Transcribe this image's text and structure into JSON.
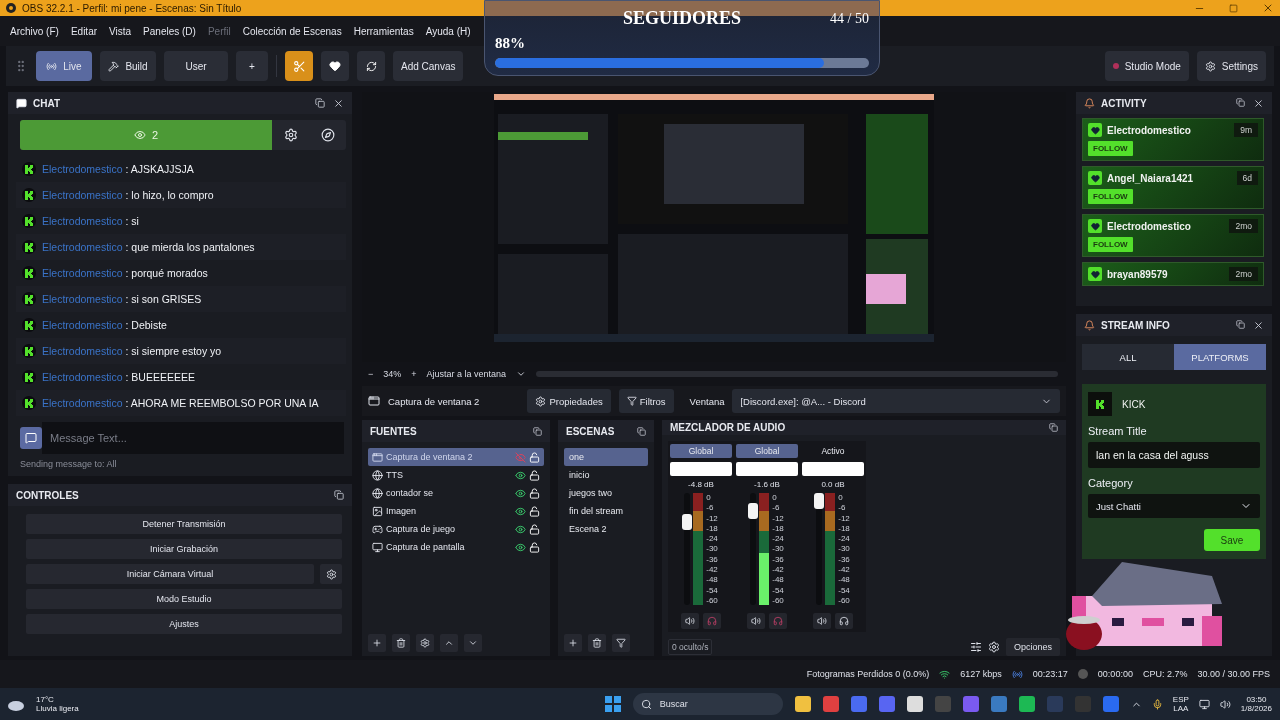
{
  "window": {
    "title": "OBS 32.2.1 - Perfil: mi pene - Escenas: Sin Título"
  },
  "menu": [
    {
      "label": "Archivo (F)",
      "disabled": false
    },
    {
      "label": "Editar",
      "disabled": false
    },
    {
      "label": "Vista",
      "disabled": false
    },
    {
      "label": "Paneles (D)",
      "disabled": false
    },
    {
      "label": "Perfil",
      "disabled": true
    },
    {
      "label": "Colección de Escenas",
      "disabled": false
    },
    {
      "label": "Herramientas",
      "disabled": false
    },
    {
      "label": "Ayuda (H)",
      "disabled": false
    }
  ],
  "toolbar": {
    "modes": [
      {
        "label": "Live",
        "kind": "live",
        "selected": true
      },
      {
        "label": "Build",
        "kind": "build",
        "selected": false
      },
      {
        "label": "User",
        "kind": "user",
        "selected": false
      }
    ],
    "add": "+",
    "tools": [
      {
        "kind": "tools",
        "active": true
      },
      {
        "kind": "favorite",
        "active": false
      },
      {
        "kind": "swap",
        "active": false
      }
    ],
    "add_canvas": "Add Canvas",
    "studio_mode": "Studio Mode",
    "settings": "Settings"
  },
  "goal_overlay": {
    "title": "SEGUIDORES",
    "count": "44 / 50",
    "percent": "88%",
    "level": 0.88
  },
  "chat": {
    "title": "CHAT",
    "viewers": "2",
    "separator": ":",
    "messages": [
      {
        "user": "Electrodomestico",
        "text": "AJSKAJJSJA"
      },
      {
        "user": "Electrodomestico",
        "text": "lo hizo, lo compro"
      },
      {
        "user": "Electrodomestico",
        "text": "si"
      },
      {
        "user": "Electrodomestico",
        "text": "que mierda los pantalones"
      },
      {
        "user": "Electrodomestico",
        "text": "porqué morados"
      },
      {
        "user": "Electrodomestico",
        "text": "si son GRISES"
      },
      {
        "user": "Electrodomestico",
        "text": "Debiste"
      },
      {
        "user": "Electrodomestico",
        "text": "si siempre estoy yo"
      },
      {
        "user": "Electrodomestico",
        "text": "BUEEEEEEE"
      },
      {
        "user": "Electrodomestico",
        "text": "AHORA ME REEMBOLSO POR UNA IA"
      }
    ],
    "input": {
      "placeholder": "Message Text..."
    },
    "sending_to": "Sending message to: All"
  },
  "controls": {
    "title": "CONTROLES",
    "buttons": [
      "Detener Transmisión",
      "Iniciar Grabación",
      "Iniciar Cámara Virtual",
      "Modo Estudio",
      "Ajustes"
    ]
  },
  "preview": {
    "zoom_out": "−",
    "zoom": "34%",
    "zoom_in": "+",
    "fit": "Ajustar a la ventana"
  },
  "source_bar": {
    "source": "Captura de ventana 2",
    "properties": "Propiedades",
    "filters": "Filtros",
    "window_label": "Ventana",
    "window_value": "[Discord.exe]: @A... - Discord"
  },
  "sources": {
    "title": "FUENTES",
    "items": [
      {
        "name": "Captura de ventana 2",
        "kind": "window",
        "selected": true,
        "visible": false
      },
      {
        "name": "TTS",
        "kind": "browser",
        "selected": false,
        "visible": true
      },
      {
        "name": "contador se",
        "kind": "browser",
        "selected": false,
        "visible": true
      },
      {
        "name": "Imagen",
        "kind": "image",
        "selected": false,
        "visible": true
      },
      {
        "name": "Captura de juego",
        "kind": "game",
        "selected": false,
        "visible": true
      },
      {
        "name": "Captura de pantalla",
        "kind": "display",
        "selected": false,
        "visible": true
      }
    ]
  },
  "scenes": {
    "title": "ESCENAS",
    "items": [
      {
        "name": "one",
        "selected": true
      },
      {
        "name": "inicio",
        "selected": false
      },
      {
        "name": "juegos two",
        "selected": false
      },
      {
        "name": "fin del stream",
        "selected": false
      },
      {
        "name": "Escena 2",
        "selected": false
      }
    ]
  },
  "mixer": {
    "title": "MEZCLADOR DE AUDIO",
    "hidden": "0 oculto/s",
    "options": "Opciones",
    "channels": [
      {
        "tag": "Global",
        "tag_selected": true,
        "db": "-4.8 dB",
        "level": 0.78,
        "monitoring": true,
        "scale": [
          "0",
          "-6",
          "-12",
          "-18",
          "-24",
          "-30",
          "-36",
          "-42",
          "-48",
          "-54",
          "-60"
        ]
      },
      {
        "tag": "Global",
        "tag_selected": true,
        "db": "-1.6 dB",
        "level": 0.9,
        "monitoring": true,
        "scale": [
          "0",
          "-6",
          "-12",
          "-18",
          "-24",
          "-30",
          "-36",
          "-42",
          "-48",
          "-54",
          "-60"
        ]
      },
      {
        "tag": "Activo",
        "tag_selected": false,
        "db": "0.0 dB",
        "level": 1,
        "monitoring": false,
        "scale": [
          "0",
          "-6",
          "-12",
          "-18",
          "-24",
          "-30",
          "-36",
          "-42",
          "-48",
          "-54",
          "-60"
        ]
      }
    ]
  },
  "activity": {
    "title": "ACTIVITY",
    "events": [
      {
        "user": "Electrodomestico",
        "time": "9m",
        "action": "FOLLOW"
      },
      {
        "user": "Angel_Naiara1421",
        "time": "6d",
        "action": "FOLLOW"
      },
      {
        "user": "Electrodomestico",
        "time": "2mo",
        "action": "FOLLOW"
      },
      {
        "user": "brayan89579",
        "time": "2mo"
      }
    ]
  },
  "stream_info": {
    "title": "STREAM INFO",
    "tabs": [
      {
        "label": "ALL",
        "selected": false
      },
      {
        "label": "PLATFORMS",
        "selected": true
      }
    ],
    "platform": "KICK",
    "title_label": "Stream Title",
    "title_value": "lan en la casa del aguss",
    "category_label": "Category",
    "category_value": "Just Chatti",
    "save": "Save"
  },
  "status_bar": {
    "dropped": "Fotogramas Perdidos 0 (0.0%)",
    "bitrate": "6127 kbps",
    "stream_time": "00:23:17",
    "record_time": "00:00:00",
    "cpu": "CPU: 2.7%",
    "fps": "30.00 / 30.00 FPS"
  },
  "taskbar": {
    "temperature": "17°C",
    "weather": "Lluvia ligera",
    "search": "Buscar",
    "lang": "ESP",
    "layout": "LAA",
    "time": "03:50",
    "date": "1/8/2026"
  }
}
